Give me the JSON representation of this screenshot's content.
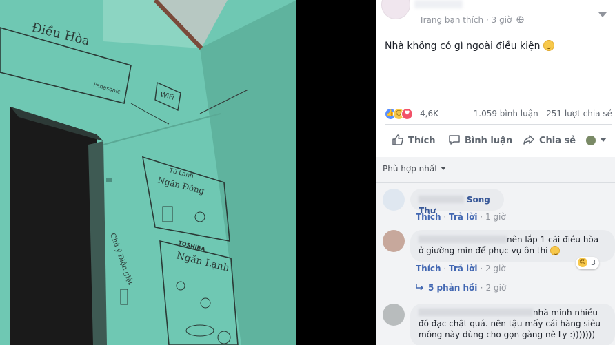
{
  "post": {
    "meta": {
      "audience": "Trang bạn thích",
      "separator": "·",
      "time": "3 giờ"
    },
    "text": "Nhà không có gì ngoài điều kiện",
    "stats": {
      "reactions": "4,6K",
      "comments": "1.059 bình luận",
      "shares": "251 lượt chia sẻ"
    },
    "actions": {
      "like": "Thích",
      "comment": "Bình luận",
      "share": "Chia sẻ"
    }
  },
  "photo": {
    "wall_labels": {
      "air_conditioner": "Điều Hòa",
      "brand_ac": "Panasonic",
      "wifi": "WiFi",
      "fridge": "Tủ Lạnh",
      "freezer": "Ngăn Đông",
      "brand_fridge": "TOSHIBA",
      "cooler": "Ngăn Lạnh",
      "note": "Chú ý Điện giật"
    }
  },
  "comments_section": {
    "sort_label": "Phù hợp nhất",
    "items": [
      {
        "name_visible": "Song Thư",
        "text": "",
        "like": "Thích",
        "reply": "Trả lời",
        "time": "1 giờ"
      },
      {
        "name_visible": "",
        "text": "nên lắp 1 cái điều hòa ở giường mìn để phục vụ ôn thi",
        "line1": "nên lắp 1 cái điều hòa",
        "line2": "ở giường mìn để phục vụ ôn thi",
        "like": "Thích",
        "reply": "Trả lời",
        "time": "2 giờ",
        "reaction_count": "3",
        "replies": "5 phản hồi",
        "replies_time": "2 giờ"
      },
      {
        "name_visible": "",
        "line1": "nhà mình nhiều",
        "line2": "đồ đạc chật quá. nên tậu mấy cái hàng siêu",
        "line3": "mông này dùng cho gọn gàng nè Ly :)))))))"
      }
    ]
  },
  "colors": {
    "link": "#4267b2",
    "name": "#385898",
    "bubble": "#e9ebee",
    "wall": "#6cc7b0",
    "like_blue": "#5890ff",
    "love_red": "#f25268",
    "haha_yellow": "#f7c84b"
  }
}
